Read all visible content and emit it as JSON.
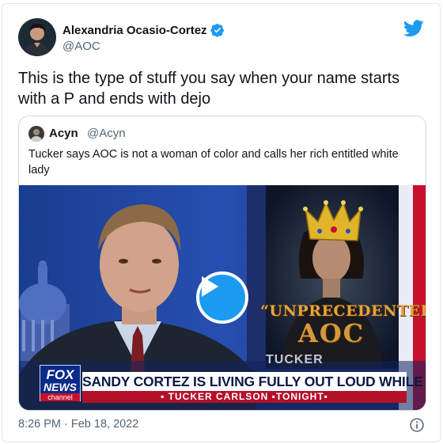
{
  "tweet": {
    "author_name": "Alexandria Ocasio-Cortez",
    "author_handle": "@AOC",
    "text": "This is the type of stuff you say when your name starts with a P and ends with dejo",
    "timestamp": "8:26 PM · Feb 18, 2022"
  },
  "quoted": {
    "author_name": "Acyn",
    "author_handle": "@Acyn",
    "text": "Tucker says AOC is not a woman of color and calls her rich entitled white lady"
  },
  "video": {
    "graphic_title": "“UNPRECEDENTED”",
    "graphic_subtitle": "AOC",
    "segment_tag": "TUCKER",
    "network_line1": "FOX",
    "network_line2": "NEWS",
    "network_line3": "channel",
    "chyron": "SANDY CORTEZ IS LIVING FULLY OUT LOUD WHILE FEMALE",
    "show_name": "▪ TUCKER CARLSON ▪TONIGHT▪"
  },
  "icons": {
    "brand": "twitter-bird-icon",
    "verified": "verified-badge-icon",
    "play": "play-icon",
    "info": "info-icon"
  },
  "colors": {
    "brand_blue": "#1d9bf0",
    "muted_text": "#536471",
    "border": "#cfd9de"
  }
}
